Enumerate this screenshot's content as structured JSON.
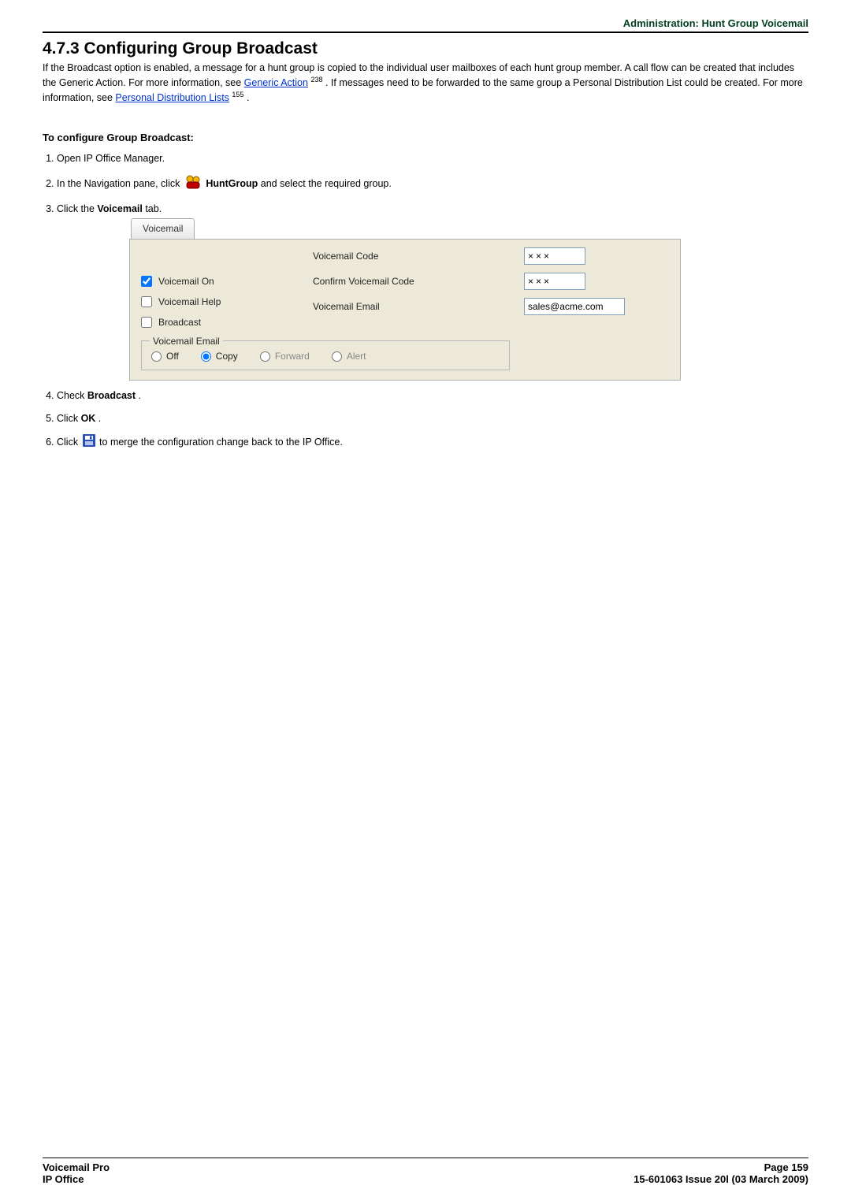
{
  "header": {
    "adminLine": "Administration: Hunt Group Voicemail"
  },
  "title": "4.7.3 Configuring Group Broadcast",
  "intro": {
    "p1a": "If the Broadcast option is enabled, a message for a hunt group is copied to the individual user mailboxes of each hunt group member. A call flow can be created that includes the Generic Action. For more information, see ",
    "link1": "Generic Action",
    "ref1": "238",
    "p1b": ". If messages need to be forwarded to the same group a Personal Distribution List could be created. For more information, see ",
    "link2": "Personal Distribution Lists",
    "ref2": "155",
    "p1c": "."
  },
  "subhead": "To configure Group Broadcast:",
  "steps": {
    "s1": "Open IP Office Manager.",
    "s2a": "In the Navigation pane, click ",
    "s2b": " HuntGroup",
    "s2c": " and select the required group.",
    "s3a": "Click the ",
    "s3b": "Voicemail",
    "s3c": " tab.",
    "s4a": "Check ",
    "s4b": "Broadcast",
    "s4c": ".",
    "s5a": "Click ",
    "s5b": "OK",
    "s5c": ".",
    "s6a": "Click ",
    "s6b": " to merge the configuration change back to the IP Office."
  },
  "vm": {
    "tabLabel": "Voicemail",
    "codeLabel": "Voicemail Code",
    "codeValue": "×××",
    "confirmLabel": "Confirm Voicemail Code",
    "confirmValue": "×××",
    "emailLabel": "Voicemail Email",
    "emailValue": "sales@acme.com",
    "groupLegend": "Voicemail Email",
    "radioOff": "Off",
    "radioCopy": "Copy",
    "radioForward": "Forward",
    "radioAlert": "Alert",
    "chkOn": "Voicemail On",
    "chkHelp": "Voicemail Help",
    "chkBroadcast": "Broadcast"
  },
  "footer": {
    "leftTop": "Voicemail Pro",
    "leftBottom": "IP Office",
    "rightTop": "Page 159",
    "rightBottom": "15-601063 Issue 20l (03 March 2009)"
  }
}
